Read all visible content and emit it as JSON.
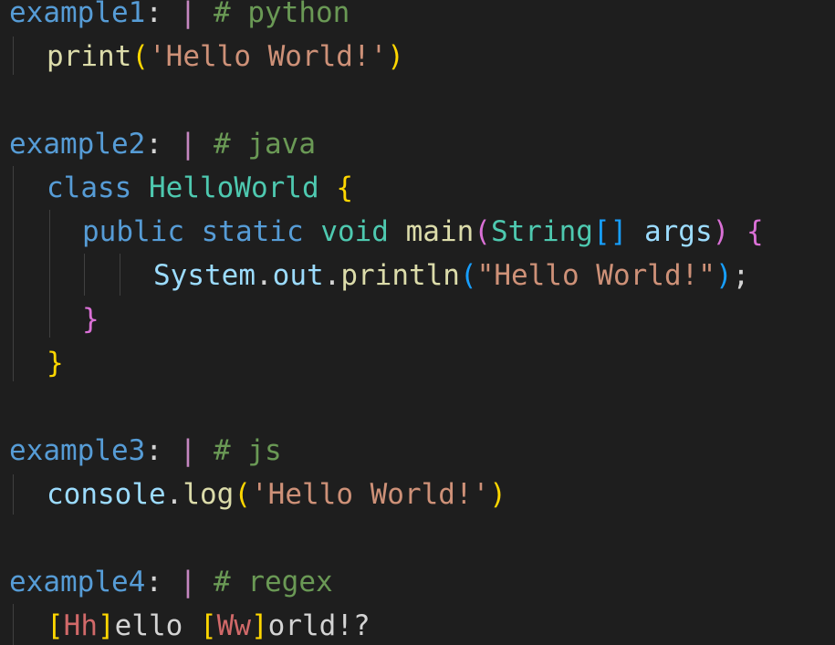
{
  "code": {
    "example1": {
      "key": "example1",
      "colon": ":",
      "pipe": "|",
      "comment": "# python",
      "body": {
        "fn": "print",
        "open": "(",
        "str": "'Hello World!'",
        "close": ")"
      }
    },
    "example2": {
      "key": "example2",
      "colon": ":",
      "pipe": "|",
      "comment": "# java",
      "class_kw": "class",
      "class_name": "HelloWorld",
      "class_open": "{",
      "method_mods": "public static",
      "method_void": "void",
      "method_name": "main",
      "paren_open": "(",
      "param_type": "String",
      "arr_brackets": "[]",
      "param_name": "args",
      "paren_close": ")",
      "method_open": "{",
      "stmt_obj": "System",
      "stmt_dot1": ".",
      "stmt_field": "out",
      "stmt_dot2": ".",
      "stmt_fn": "println",
      "stmt_open": "(",
      "stmt_str": "\"Hello World!\"",
      "stmt_close": ")",
      "stmt_semi": ";",
      "method_close": "}",
      "class_close": "}"
    },
    "example3": {
      "key": "example3",
      "colon": ":",
      "pipe": "|",
      "comment": "# js",
      "obj": "console",
      "dot": ".",
      "fn": "log",
      "open": "(",
      "str": "'Hello World!'",
      "close": ")"
    },
    "example4": {
      "key": "example4",
      "colon": ":",
      "pipe": "|",
      "comment": "# regex",
      "br1_open": "[",
      "cls1": "Hh",
      "br1_close": "]",
      "text1": "ello ",
      "br2_open": "[",
      "cls2": "Ww",
      "br2_close": "]",
      "text2": "orld!?"
    }
  },
  "colors": {
    "background": "#1e1e1e",
    "key": "#569cd6",
    "comment": "#6a9955",
    "string": "#ce9178",
    "function": "#dcdcaa",
    "type": "#4ec9b0",
    "bracket_gold": "#ffd700",
    "bracket_orchid": "#da70d6",
    "bracket_blue": "#179fff",
    "regex": "#d16969"
  }
}
